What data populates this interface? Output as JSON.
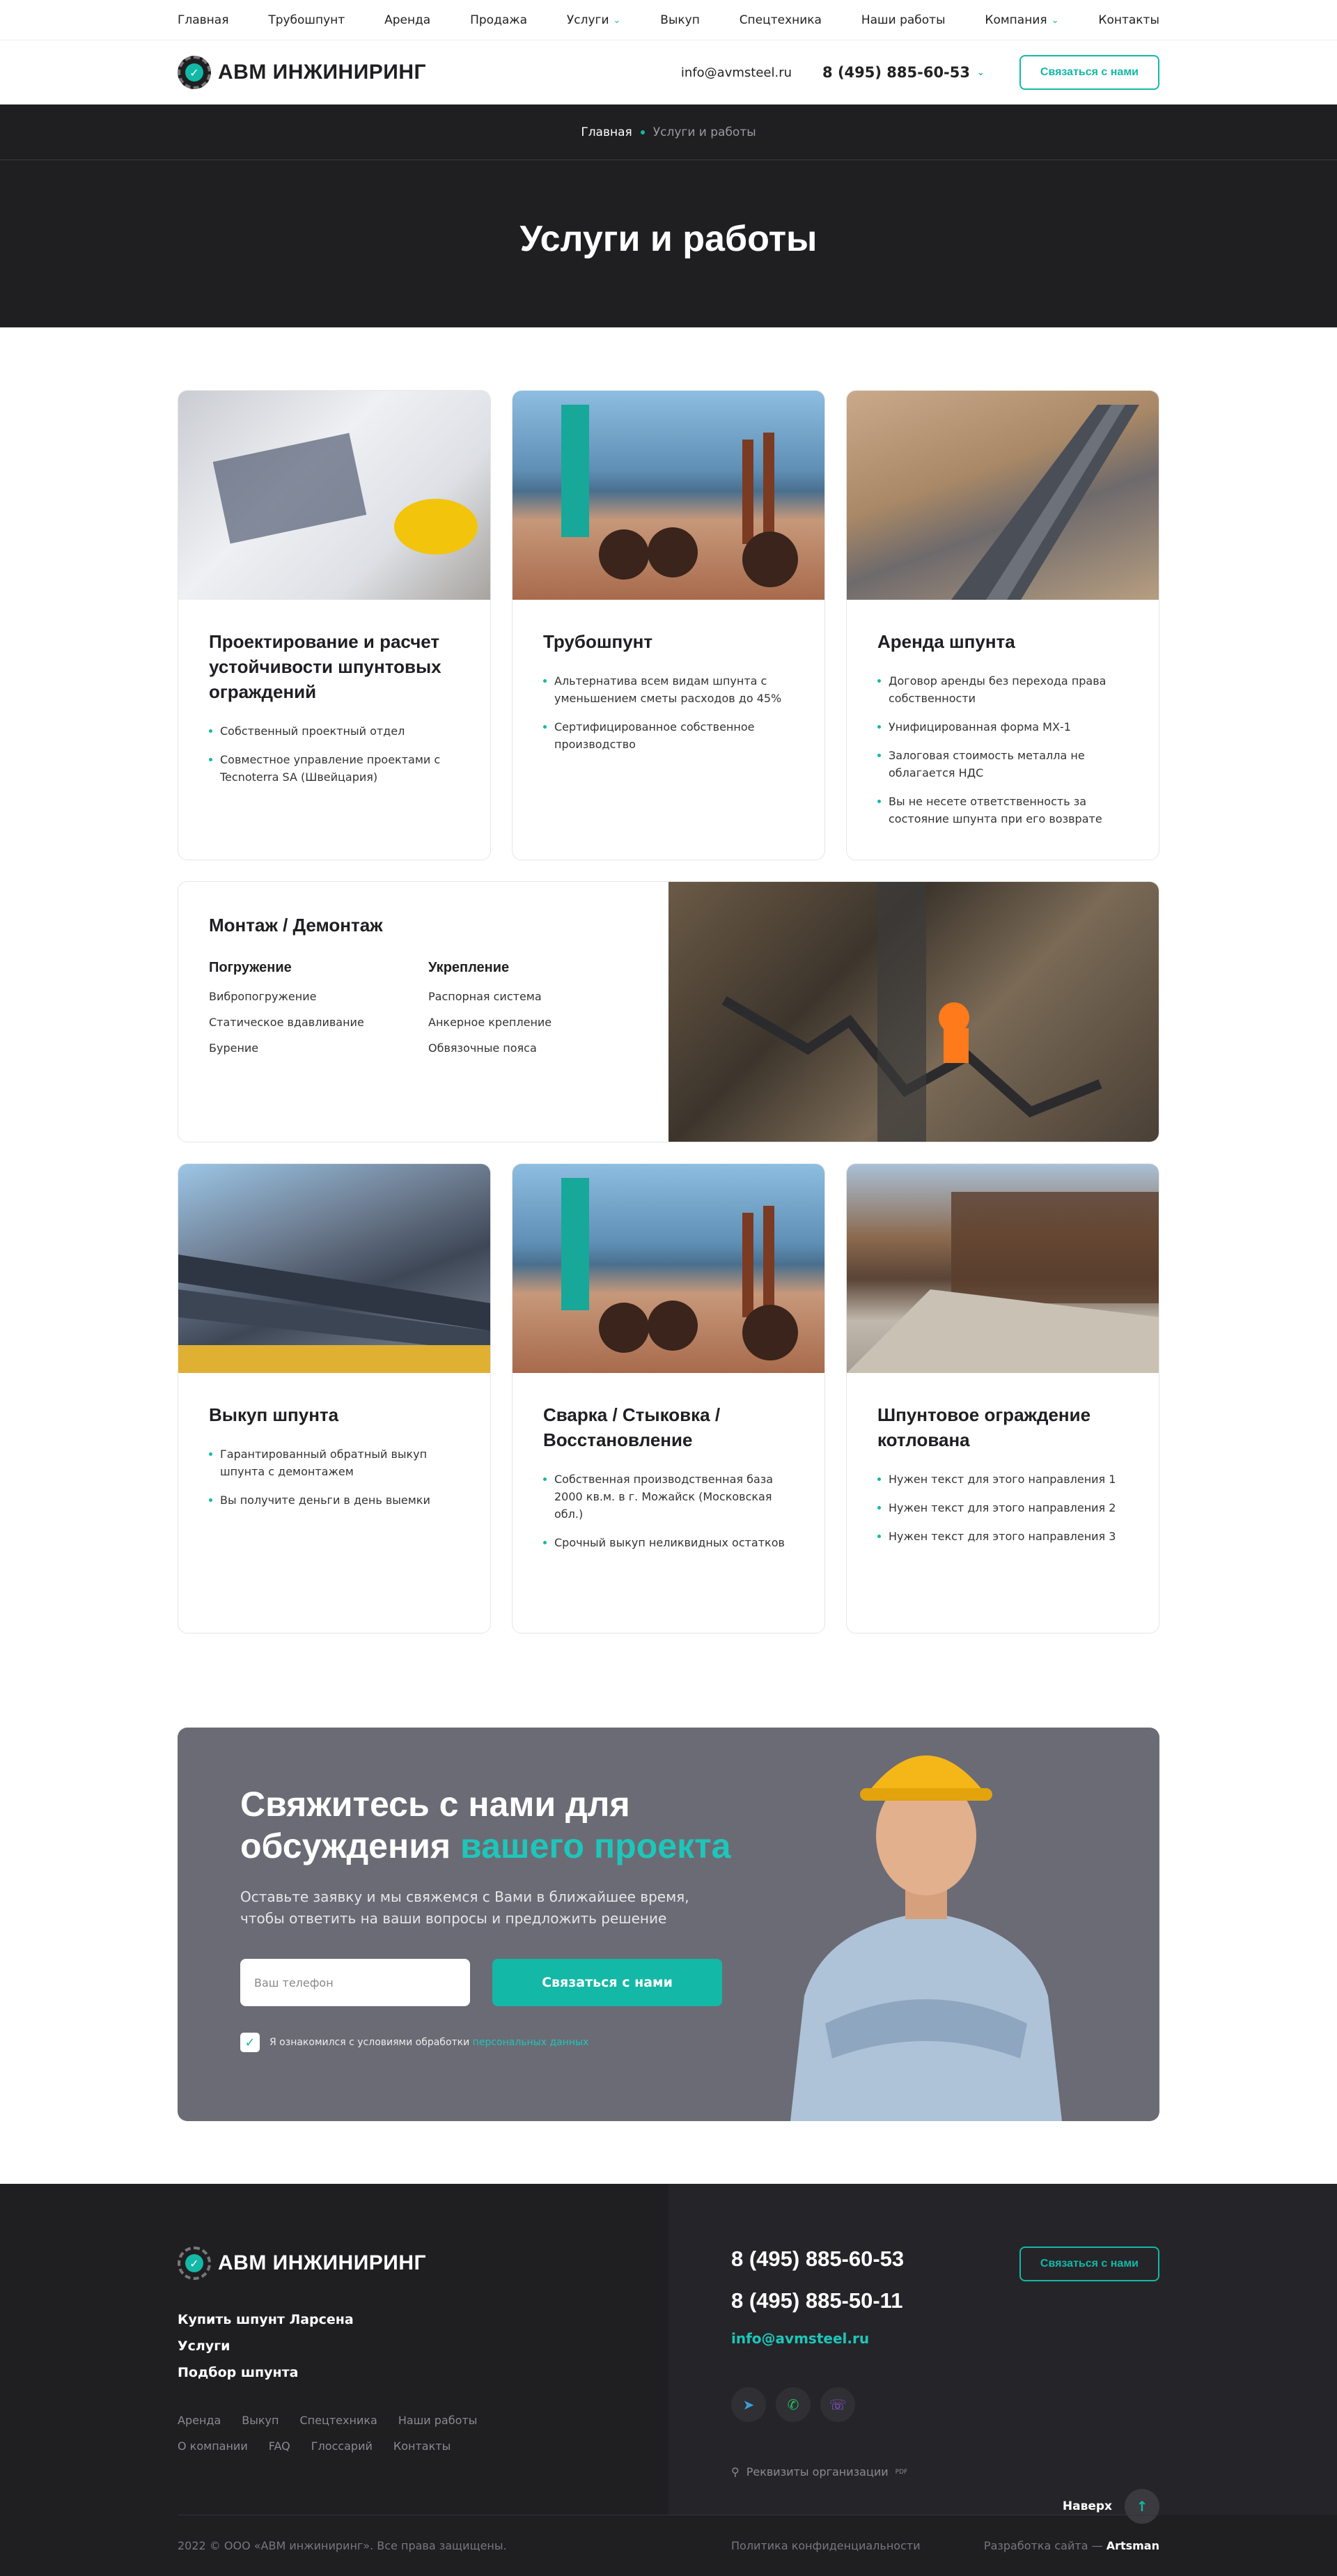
{
  "topnav": [
    {
      "label": "Главная",
      "has_menu": false
    },
    {
      "label": "Трубошпунт",
      "has_menu": false
    },
    {
      "label": "Аренда",
      "has_menu": false
    },
    {
      "label": "Продажа",
      "has_menu": false
    },
    {
      "label": "Услуги",
      "has_menu": true
    },
    {
      "label": "Выкуп",
      "has_menu": false
    },
    {
      "label": "Спецтехника",
      "has_menu": false
    },
    {
      "label": "Наши работы",
      "has_menu": false
    },
    {
      "label": "Компания",
      "has_menu": true
    },
    {
      "label": "Контакты",
      "has_menu": false
    }
  ],
  "header": {
    "logo_text": "АВМ ИНЖИНИРИНГ",
    "email": "info@avmsteel.ru",
    "phone": "8 (495) 885-60-53",
    "cta": "Связаться с нами"
  },
  "breadcrumb": {
    "home": "Главная",
    "current": "Услуги и работы"
  },
  "page_title": "Услуги и работы",
  "cards_row1": [
    {
      "title": "Проектирование и расчет устойчивости шпунтовых ограждений",
      "items": [
        "Собственный проектный отдел",
        "Совместное управление проектами с Tecnoterra SA (Швейцария)"
      ]
    },
    {
      "title": "Трубошпунт",
      "items": [
        "Альтернатива всем видам шпунта с уменьшением сметы расходов до 45%",
        "Сертифицированное собственное производство"
      ]
    },
    {
      "title": "Аренда шпунта",
      "items": [
        "Договор аренды без перехода права собственности",
        "Унифицированная форма МХ-1",
        "Залоговая стоимость металла не облагается НДС",
        "Вы не несете ответственность за состояние шпунта при его возврате"
      ]
    }
  ],
  "mount": {
    "title": "Монтаж / Демонтаж",
    "col1": {
      "title": "Погружение",
      "items": [
        "Вибропогружение",
        "Статическое вдавливание",
        "Бурение"
      ]
    },
    "col2": {
      "title": "Укрепление",
      "items": [
        "Распорная система",
        "Анкерное крепление",
        "Обвязочные пояса"
      ]
    }
  },
  "cards_row2": [
    {
      "title": "Выкуп шпунта",
      "items": [
        "Гарантированный обратный выкуп шпунта с демонтажем",
        "Вы получите деньги в день выемки"
      ]
    },
    {
      "title": "Сварка / Стыковка / Восстановление",
      "items": [
        "Собственная производственная база 2000 кв.м. в г. Можайск (Московская обл.)",
        "Срочный выкуп неликвидных остатков"
      ]
    },
    {
      "title": "Шпунтовое ограждение котлована",
      "items": [
        "Нужен текст для этого направления 1",
        "Нужен текст для этого направления 2",
        "Нужен текст для этого направления 3"
      ]
    }
  ],
  "cta": {
    "title_part1": "Свяжитесь с нами для обсуждения",
    "title_accent": "вашего проекта",
    "text": "Оставьте заявку и мы свяжемся с Вами в ближайшее время, чтобы ответить на ваши вопросы и предложить решение",
    "phone_placeholder": "Ваш телефон",
    "button": "Связаться с нами",
    "consent": "Я ознакомился с условиями обработки",
    "consent_link": "персональных данных"
  },
  "footer": {
    "logo_text": "АВМ ИНЖИНИРИНГ",
    "main_links": [
      "Купить шпунт Ларсена",
      "Услуги",
      "Подбор шпунта"
    ],
    "small_links": [
      "Аренда",
      "Выкуп",
      "Спецтехника",
      "Наши работы",
      "О компании",
      "FAQ",
      "Глоссарий",
      "Контакты"
    ],
    "phone1": "8 (495) 885-60-53",
    "phone2": "8 (495) 885-50-11",
    "email": "info@avmsteel.ru",
    "cta": "Связаться с нами",
    "requisites": "Реквизиты организации",
    "requisites_format": "PDF",
    "to_top": "Наверх",
    "copyright": "2022 © ООО «АВМ инжиниринг». Все права защищены.",
    "policy": "Политика конфиденциальности",
    "dev_label": "Разработка сайта —",
    "dev_name": "Artsman"
  },
  "colors": {
    "accent": "#14b8a6",
    "dark": "#1f1f22",
    "cta_bg": "#6b6b75"
  }
}
